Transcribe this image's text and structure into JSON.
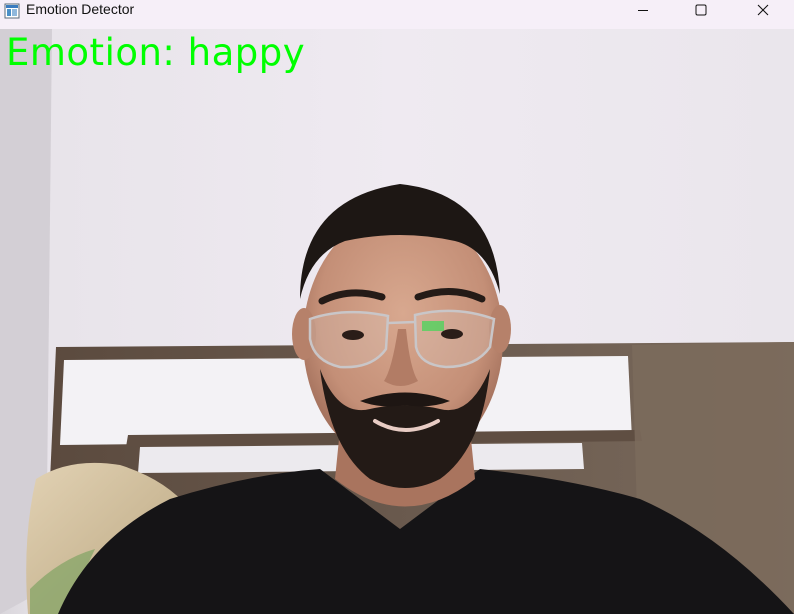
{
  "window": {
    "title": "Emotion Detector",
    "app_icon": "python-window-icon"
  },
  "caption_buttons": {
    "minimize_icon": "minimize-icon",
    "maximize_icon": "maximize-icon",
    "close_icon": "close-icon"
  },
  "overlay": {
    "emotion_text": "Emotion: happy",
    "text_color": "#00ff00"
  },
  "colors": {
    "titlebar_bg": "#f6eff8"
  }
}
